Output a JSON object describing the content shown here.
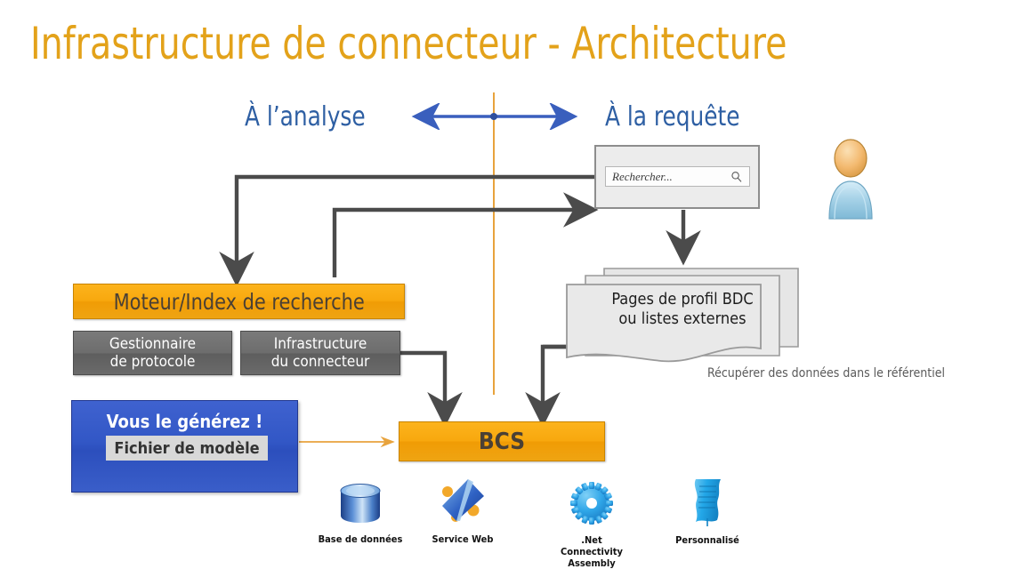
{
  "slide": {
    "title": "Infrastructure de connecteur - Architecture",
    "title_color": "#e3a21a",
    "background": "#ffffff"
  },
  "axis": {
    "left_label": "À l’analyse",
    "right_label": "À la requête",
    "label_color": "#2e5fa3",
    "arrow_color": "#3a5fbd",
    "divider_color": "#e8a33d"
  },
  "search_panel": {
    "name": "search-panel",
    "placeholder": "Rechercher...",
    "icon": "search-icon",
    "panel_color": "#ececec",
    "border_color": "#8d8d8d"
  },
  "user": {
    "icon": "user-icon",
    "head_color": "#f0b86e",
    "body_color": "#a7d4e8"
  },
  "boxes": {
    "search_engine": {
      "label": "Moteur/Index de recherche",
      "color": "#f8a80e",
      "text_color": "#4a4035"
    },
    "protocol_handler": {
      "line1": "Gestionnaire",
      "line2": "de protocole",
      "color": "#6d6d6d",
      "text_color": "#ffffff"
    },
    "connector_framework": {
      "line1": "Infrastructure",
      "line2": "du connecteur",
      "color": "#6d6d6d",
      "text_color": "#ffffff"
    },
    "bcs": {
      "label": "BCS",
      "color": "#f8a80e",
      "text_color": "#4a4035"
    },
    "generate": {
      "title": "Vous le générez !",
      "model_file": "Fichier de modèle",
      "color": "#3257c6",
      "title_color": "#ffffff",
      "inner_color": "#d8d8d8",
      "inner_text_color": "#333333"
    }
  },
  "documents": {
    "line1": "Pages de profil BDC",
    "line2": "ou listes externes",
    "fill": "#e8e8e8",
    "stroke": "#9a9a9a"
  },
  "notes": {
    "retrieve": "Récupérer des données dans le référentiel",
    "retrieve_color": "#5a5a5a"
  },
  "connector_icons": [
    {
      "icon": "database-icon",
      "caption": "Base de données"
    },
    {
      "icon": "web-service-icon",
      "caption": "Service Web"
    },
    {
      "icon": "gear-icon",
      "caption": ".Net\nConnectivity\nAssembly",
      "cap1": ".Net",
      "cap2": "Connectivity",
      "cap3": "Assembly"
    },
    {
      "icon": "custom-document-icon",
      "caption": "Personnalisé"
    }
  ]
}
